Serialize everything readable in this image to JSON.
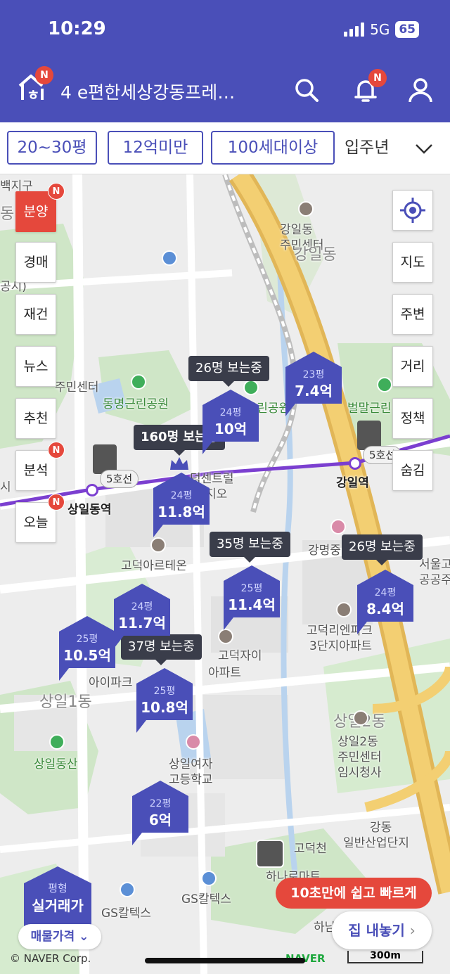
{
  "status": {
    "time": "10:29",
    "network": "5G",
    "battery": "65"
  },
  "header": {
    "title": "4 e편한세상강동프레…",
    "home_badge": "N",
    "bell_badge": "N"
  },
  "filters": [
    {
      "label": "20~30평"
    },
    {
      "label": "12억미만"
    },
    {
      "label": "100세대이상"
    }
  ],
  "filter_more": "입주년",
  "side_left": [
    {
      "label": "분양",
      "badge": "N"
    },
    {
      "label": "경매"
    },
    {
      "label": "재건"
    },
    {
      "label": "뉴스"
    },
    {
      "label": "추천"
    },
    {
      "label": "분석",
      "badge": "N"
    },
    {
      "label": "오늘",
      "badge": "N"
    }
  ],
  "side_right": [
    {
      "label": "지도"
    },
    {
      "label": "주변"
    },
    {
      "label": "거리"
    },
    {
      "label": "정책"
    },
    {
      "label": "숨김"
    }
  ],
  "map_labels": {
    "l1": "백지구",
    "l2": "강일동",
    "l3": "주민센터",
    "l4": "강일동",
    "l5": "명근린공원",
    "l6": "동명근린공원",
    "l7": "벌말근린",
    "l8": "상일동역",
    "l9": "강일역",
    "l10": "고덕아르테온",
    "l11": "강명중",
    "l12": "서울고",
    "l13": "공공주",
    "l14": "고덕리엔파크",
    "l15": "3단지아파트",
    "l16": "고덕자이",
    "l17": "아파트",
    "l18": "아이파크",
    "l19": "상일1동",
    "l20": "상일2동",
    "l21": "상일2동",
    "l22": "주민센터",
    "l23": "임시청사",
    "l24": "상일동산",
    "l25": "상일여자",
    "l26": "고등학교",
    "l27": "강동",
    "l28": "일반산업단지",
    "l29": "고덕천",
    "l30": "하나로마트",
    "l31": "GS칼텍스",
    "l32": "GS칼텍스",
    "l33": "하남",
    "l34": "덕센트럴",
    "l35": "지오",
    "l36": "주민센터",
    "l37": "동",
    "l38": "공시)",
    "l39": "시"
  },
  "stations": {
    "line_tag": "5호선",
    "line_tag2": "5호선"
  },
  "markers": [
    {
      "size": "24평",
      "price": "10억"
    },
    {
      "size": "23평",
      "price": "7.4억"
    },
    {
      "size": "24평",
      "price": "11.8억"
    },
    {
      "size": "25평",
      "price": "11.4억"
    },
    {
      "size": "24평",
      "price": "8.4억"
    },
    {
      "size": "24평",
      "price": "11.7억"
    },
    {
      "size": "25평",
      "price": "10.5억"
    },
    {
      "size": "25평",
      "price": "10.8억"
    },
    {
      "size": "22평",
      "price": "6억"
    }
  ],
  "viewers": [
    {
      "text": "26명 보는중"
    },
    {
      "text": "160명 보는중"
    },
    {
      "text": "35명 보는중"
    },
    {
      "text": "26명 보는중"
    },
    {
      "text": "37명 보는중"
    }
  ],
  "trade_marker": {
    "size": "평형",
    "label": "실거래가"
  },
  "price_type": "매물가격",
  "promo": "10초만에 쉽고 빠르게",
  "list_button": "집 내놓기",
  "copyright": "© NAVER Corp.",
  "naver": "NAVER",
  "scale": "300m",
  "colors": {
    "primary": "#4a4fb8",
    "badge": "#e5483c",
    "viewer_bg": "#3a3d4a",
    "subway_line": "#7b3fd0"
  }
}
